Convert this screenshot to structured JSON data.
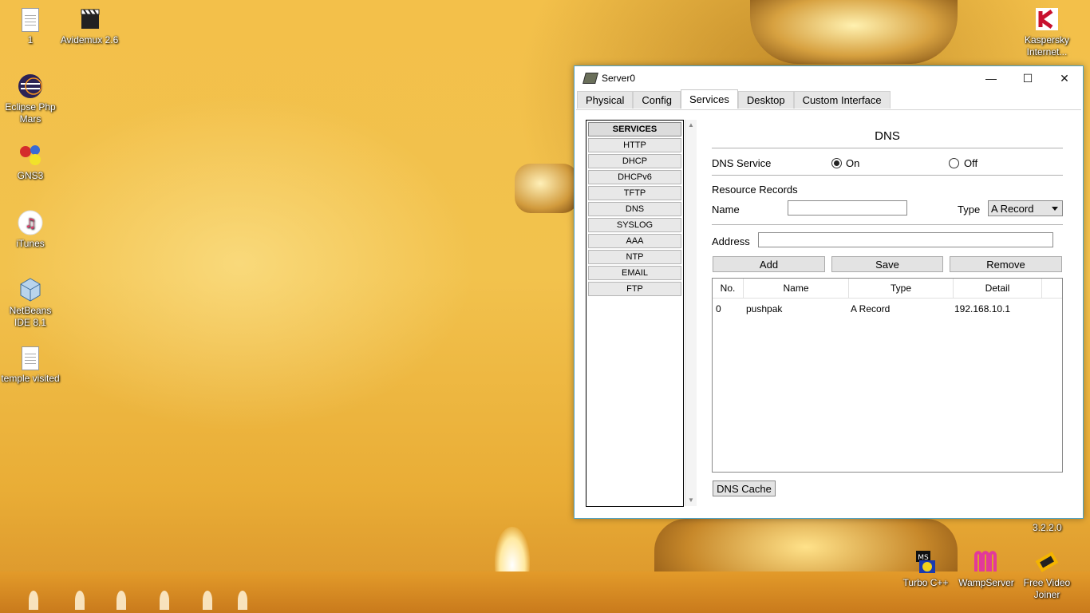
{
  "desktop": {
    "icons_left": [
      {
        "label": "1",
        "icon": "text-file-icon"
      },
      {
        "label": "Avidemux 2.6",
        "icon": "avidemux-icon"
      },
      {
        "label": "Eclipse Php Mars",
        "icon": "eclipse-icon"
      },
      {
        "label": "GNS3",
        "icon": "gns3-icon"
      },
      {
        "label": "iTunes",
        "icon": "itunes-icon"
      },
      {
        "label": "NetBeans IDE 8.1",
        "icon": "netbeans-icon"
      },
      {
        "label": "temple visited",
        "icon": "text-file-icon"
      }
    ],
    "icons_right": [
      {
        "label": "Kaspersky Internet...",
        "icon": "kaspersky-icon"
      },
      {
        "label": "Turbo C++",
        "icon": "turbo-cpp-icon"
      },
      {
        "label": "WampServer",
        "icon": "wampserver-icon"
      },
      {
        "label": "Free Video Joiner",
        "icon": "free-video-joiner-icon"
      }
    ],
    "version_text": "3.2.2.0"
  },
  "window": {
    "title": "Server0",
    "controls": {
      "minimize": "—",
      "maximize": "☐",
      "close": "✕"
    },
    "tabs": [
      "Physical",
      "Config",
      "Services",
      "Desktop",
      "Custom Interface"
    ],
    "active_tab": "Services"
  },
  "services": {
    "header": "SERVICES",
    "items": [
      "HTTP",
      "DHCP",
      "DHCPv6",
      "TFTP",
      "DNS",
      "SYSLOG",
      "AAA",
      "NTP",
      "EMAIL",
      "FTP"
    ]
  },
  "dns": {
    "title": "DNS",
    "service_label": "DNS Service",
    "on_label": "On",
    "off_label": "Off",
    "service_state": "On",
    "records_label": "Resource Records",
    "name_label": "Name",
    "name_value": "",
    "type_label": "Type",
    "type_value": "A Record",
    "address_label": "Address",
    "address_value": "",
    "buttons": {
      "add": "Add",
      "save": "Save",
      "remove": "Remove"
    },
    "table": {
      "headers": [
        "No.",
        "Name",
        "Type",
        "Detail"
      ],
      "rows": [
        {
          "no": "0",
          "name": "pushpak",
          "type": "A Record",
          "detail": "192.168.10.1"
        }
      ]
    },
    "cache_button": "DNS Cache"
  }
}
